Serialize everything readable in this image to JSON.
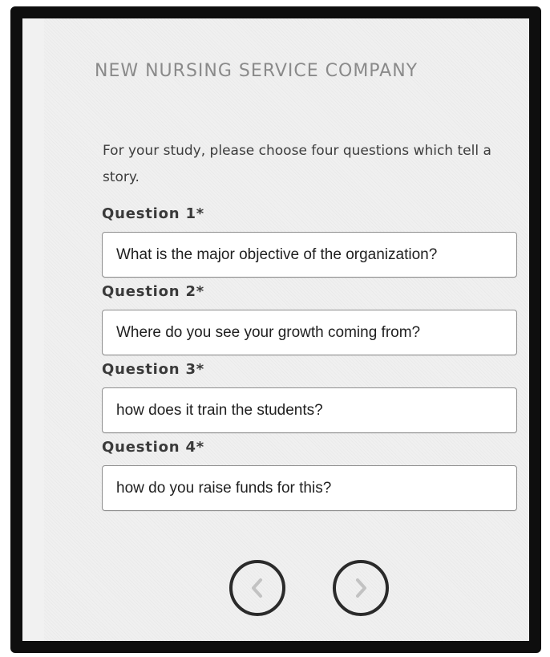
{
  "header": {
    "title": "NEW NURSING SERVICE COMPANY"
  },
  "intro": {
    "text": "For your study, please choose four questions which tell a story."
  },
  "questions": [
    {
      "label": "Question 1*",
      "value": "What is the major objective of the organization?"
    },
    {
      "label": "Question 2*",
      "value": "Where do you see your growth coming from?"
    },
    {
      "label": "Question 3*",
      "value": "how does it train the students?"
    },
    {
      "label": "Question 4*",
      "value": "how do you raise funds for this?"
    }
  ],
  "navigation": {
    "prev_icon": "chevron-left-icon",
    "next_icon": "chevron-right-icon",
    "icon_color": "#c2c2c2",
    "border_color": "#2a2a2a"
  }
}
